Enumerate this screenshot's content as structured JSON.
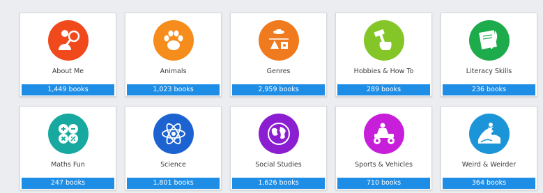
{
  "categories": [
    {
      "name": "About Me",
      "count": "1,449 books",
      "color": "#f04a1c",
      "icon": "person-magnifier-icon"
    },
    {
      "name": "Animals",
      "count": "1,023 books",
      "color": "#f58c1b",
      "icon": "paw-icon"
    },
    {
      "name": "Genres",
      "count": "2,959 books",
      "color": "#f07a1e",
      "icon": "genres-collage-icon"
    },
    {
      "name": "Hobbies & How To",
      "count": "289 books",
      "color": "#84c627",
      "icon": "hammer-fist-icon"
    },
    {
      "name": "Literacy Skills",
      "count": "236 books",
      "color": "#1eab4b",
      "icon": "scroll-quill-icon"
    },
    {
      "name": "Maths Fun",
      "count": "247 books",
      "color": "#17a9a0",
      "icon": "math-operators-icon"
    },
    {
      "name": "Science",
      "count": "1,801 books",
      "color": "#1c63d1",
      "icon": "atom-icon"
    },
    {
      "name": "Social Studies",
      "count": "1,626 books",
      "color": "#8b1ed1",
      "icon": "globe-icon"
    },
    {
      "name": "Sports & Vehicles",
      "count": "710 books",
      "color": "#c71fd9",
      "icon": "atv-rider-icon"
    },
    {
      "name": "Weird & Weirder",
      "count": "364 books",
      "color": "#1b95d8",
      "icon": "wave-surfer-icon"
    }
  ]
}
